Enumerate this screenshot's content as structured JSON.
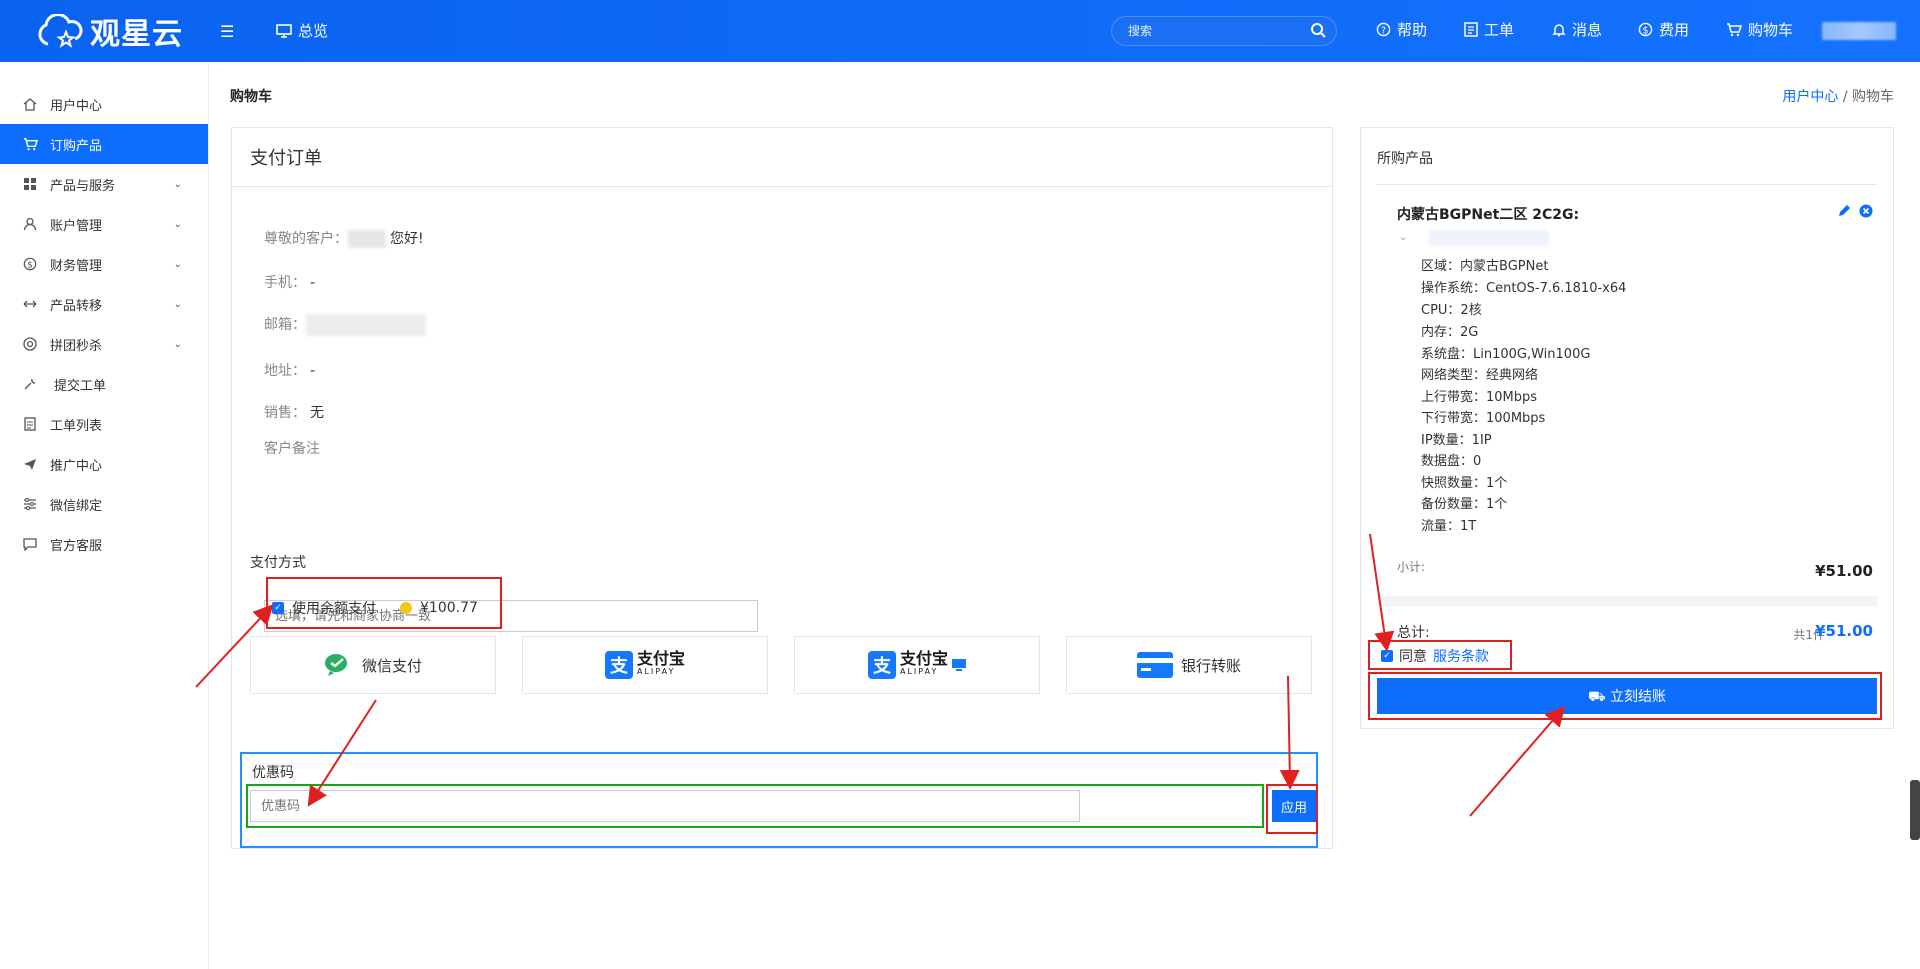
{
  "brand": {
    "name": "观星云"
  },
  "topnav": {
    "home": "总览",
    "search_placeholder": "搜索",
    "help": "帮助",
    "ticket": "工单",
    "message": "消息",
    "fees": "费用",
    "cart": "购物车"
  },
  "sidebar": {
    "items": [
      {
        "label": "用户中心",
        "icon": "home-icon"
      },
      {
        "label": "订购产品",
        "icon": "cart-icon",
        "active": true
      },
      {
        "label": "产品与服务",
        "icon": "grid-icon"
      },
      {
        "label": "账户管理",
        "icon": "user-icon"
      },
      {
        "label": "财务管理",
        "icon": "dollar-icon"
      },
      {
        "label": "产品转移",
        "icon": "transfer-icon"
      },
      {
        "label": "拼团秒杀",
        "icon": "group-icon"
      },
      {
        "label": "提交工单",
        "icon": "wrench-icon"
      },
      {
        "label": "工单列表",
        "icon": "doc-icon"
      },
      {
        "label": "推广中心",
        "icon": "send-icon"
      },
      {
        "label": "微信绑定",
        "icon": "sliders-icon"
      },
      {
        "label": "官方客服",
        "icon": "chat-icon"
      }
    ]
  },
  "page": {
    "title": "购物车",
    "breadcrumb": {
      "home": "用户中心",
      "sep": "/",
      "current": "购物车"
    }
  },
  "order": {
    "header": "支付订单",
    "greeting_label": "尊敬的客户：",
    "greeting_suffix": "您好!",
    "phone_label": "手机：",
    "phone_value": "-",
    "email_label": "邮箱：",
    "address_label": "地址：",
    "address_value": "-",
    "sales_label": "销售：",
    "sales_value": "无",
    "remark_label": "客户备注",
    "remark_placeholder": "选填，请先和商家协商一致",
    "pay_method_label": "支付方式",
    "balance_label": "使用余额支付",
    "balance_value": "¥100.77",
    "methods": [
      {
        "label": "微信支付"
      },
      {
        "label": "支付宝",
        "sub": "ALIPAY"
      },
      {
        "label": "支付宝",
        "sub": "ALIPAY"
      },
      {
        "label": "银行转账"
      }
    ],
    "coupon_label": "优惠码",
    "coupon_placeholder": "优惠码",
    "apply": "应用"
  },
  "summary": {
    "header": "所购产品",
    "product_title": "内蒙古BGPNet二区 2C2G:",
    "specs": [
      "区域：内蒙古BGPNet",
      "操作系统：CentOS-7.6.1810-x64",
      "CPU：2核",
      "内存：2G",
      "系统盘：Lin100G,Win100G",
      "网络类型：经典网络",
      "上行带宽：10Mbps",
      "下行带宽：100Mbps",
      "IP数量：1IP",
      "数据盘：0",
      "快照数量：1个",
      "备份数量：1个",
      "流量：1T"
    ],
    "subtotal_label": "小计:",
    "subtotal_value": "¥51.00",
    "total_label": "总计:",
    "total_count": "共1件",
    "total_value": "¥51.00",
    "agree_prefix": "同意",
    "agree_link": "服务条款",
    "checkout": "立刻结账"
  },
  "colors": {
    "primary": "#0d6efd",
    "annotation_red": "#e02020",
    "annotation_green": "#1aa31a"
  }
}
